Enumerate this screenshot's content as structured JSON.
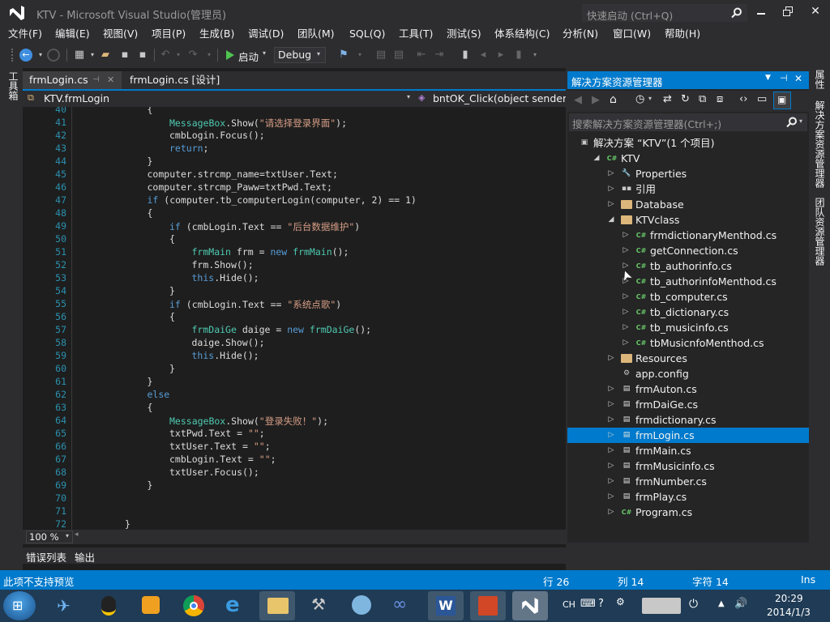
{
  "window": {
    "title": "KTV - Microsoft Visual Studio(管理员)",
    "quick_launch_placeholder": "快速启动 (Ctrl+Q)"
  },
  "menu": [
    "文件(F)",
    "编辑(E)",
    "视图(V)",
    "项目(P)",
    "生成(B)",
    "调试(D)",
    "团队(M)",
    "SQL(Q)",
    "工具(T)",
    "测试(S)",
    "体系结构(C)",
    "分析(N)",
    "窗口(W)",
    "帮助(H)"
  ],
  "toolbar": {
    "start_label": "启动",
    "config_value": "Debug"
  },
  "left_strip": {
    "toolbox_label": "工具箱"
  },
  "right_strip": {
    "properties_label": "属性",
    "solution_explorer_label": "解决方案资源管理器",
    "team_explorer_label": "团队资源管理器"
  },
  "editor": {
    "tabs": [
      {
        "label": "frmLogin.cs",
        "active": true
      },
      {
        "label": "frmLogin.cs [设计]",
        "active": false
      }
    ],
    "nav_left": "KTV.frmLogin",
    "nav_right": "bntOK_Click(object sender, E",
    "zoom": "100 %",
    "lines": [
      {
        "n": "40",
        "indent": 3,
        "parts": [
          [
            "p",
            "{"
          ]
        ]
      },
      {
        "n": "41",
        "indent": 4,
        "parts": [
          [
            "t",
            "MessageBox"
          ],
          [
            "p",
            ".Show("
          ],
          [
            "s",
            "\"请选择登录界面\""
          ],
          [
            "p",
            ");"
          ]
        ]
      },
      {
        "n": "42",
        "indent": 4,
        "parts": [
          [
            "p",
            "cmbLogin.Focus();"
          ]
        ]
      },
      {
        "n": "43",
        "indent": 4,
        "parts": [
          [
            "k",
            "return"
          ],
          [
            "p",
            ";"
          ]
        ]
      },
      {
        "n": "44",
        "indent": 3,
        "parts": [
          [
            "p",
            "}"
          ]
        ]
      },
      {
        "n": "45",
        "indent": 3,
        "parts": [
          [
            "p",
            "computer.strcmp_name=txtUser.Text;"
          ]
        ]
      },
      {
        "n": "46",
        "indent": 3,
        "parts": [
          [
            "p",
            "computer.strcmp_Paww=txtPwd.Text;"
          ]
        ]
      },
      {
        "n": "47",
        "indent": 3,
        "parts": [
          [
            "k",
            "if"
          ],
          [
            "p",
            " (computer.tb_computerLogin(computer, 2) == 1)"
          ]
        ]
      },
      {
        "n": "48",
        "indent": 3,
        "parts": [
          [
            "p",
            "{"
          ]
        ]
      },
      {
        "n": "49",
        "indent": 4,
        "parts": [
          [
            "k",
            "if"
          ],
          [
            "p",
            " (cmbLogin.Text == "
          ],
          [
            "s",
            "\"后台数据维护\""
          ],
          [
            "p",
            ")"
          ]
        ]
      },
      {
        "n": "50",
        "indent": 4,
        "parts": [
          [
            "p",
            "{"
          ]
        ]
      },
      {
        "n": "51",
        "indent": 5,
        "parts": [
          [
            "t",
            "frmMain"
          ],
          [
            "p",
            " frm = "
          ],
          [
            "k",
            "new"
          ],
          [
            "p",
            " "
          ],
          [
            "t",
            "frmMain"
          ],
          [
            "p",
            "();"
          ]
        ]
      },
      {
        "n": "52",
        "indent": 5,
        "parts": [
          [
            "p",
            "frm.Show();"
          ]
        ]
      },
      {
        "n": "53",
        "indent": 5,
        "parts": [
          [
            "k",
            "this"
          ],
          [
            "p",
            ".Hide();"
          ]
        ]
      },
      {
        "n": "54",
        "indent": 4,
        "parts": [
          [
            "p",
            "}"
          ]
        ]
      },
      {
        "n": "55",
        "indent": 4,
        "parts": [
          [
            "k",
            "if"
          ],
          [
            "p",
            " (cmbLogin.Text == "
          ],
          [
            "s",
            "\"系统点歌\""
          ],
          [
            "p",
            ")"
          ]
        ]
      },
      {
        "n": "56",
        "indent": 4,
        "parts": [
          [
            "p",
            "{"
          ]
        ]
      },
      {
        "n": "57",
        "indent": 5,
        "parts": [
          [
            "t",
            "frmDaiGe"
          ],
          [
            "p",
            " daige = "
          ],
          [
            "k",
            "new"
          ],
          [
            "p",
            " "
          ],
          [
            "t",
            "frmDaiGe"
          ],
          [
            "p",
            "();"
          ]
        ]
      },
      {
        "n": "58",
        "indent": 5,
        "parts": [
          [
            "p",
            "daige.Show();"
          ]
        ]
      },
      {
        "n": "59",
        "indent": 5,
        "parts": [
          [
            "k",
            "this"
          ],
          [
            "p",
            ".Hide();"
          ]
        ]
      },
      {
        "n": "60",
        "indent": 4,
        "parts": [
          [
            "p",
            "}"
          ]
        ]
      },
      {
        "n": "61",
        "indent": 3,
        "parts": [
          [
            "p",
            "}"
          ]
        ]
      },
      {
        "n": "62",
        "indent": 3,
        "parts": [
          [
            "k",
            "else"
          ]
        ]
      },
      {
        "n": "63",
        "indent": 3,
        "parts": [
          [
            "p",
            "{"
          ]
        ]
      },
      {
        "n": "64",
        "indent": 4,
        "parts": [
          [
            "t",
            "MessageBox"
          ],
          [
            "p",
            ".Show("
          ],
          [
            "s",
            "\"登录失败！\""
          ],
          [
            "p",
            ");"
          ]
        ]
      },
      {
        "n": "65",
        "indent": 4,
        "parts": [
          [
            "p",
            "txtPwd.Text = "
          ],
          [
            "s",
            "\"\""
          ],
          [
            "p",
            ";"
          ]
        ]
      },
      {
        "n": "66",
        "indent": 4,
        "parts": [
          [
            "p",
            "txtUser.Text = "
          ],
          [
            "s",
            "\"\""
          ],
          [
            "p",
            ";"
          ]
        ]
      },
      {
        "n": "67",
        "indent": 4,
        "parts": [
          [
            "p",
            "cmbLogin.Text = "
          ],
          [
            "s",
            "\"\""
          ],
          [
            "p",
            ";"
          ]
        ]
      },
      {
        "n": "68",
        "indent": 4,
        "parts": [
          [
            "p",
            "txtUser.Focus();"
          ]
        ]
      },
      {
        "n": "69",
        "indent": 3,
        "parts": [
          [
            "p",
            "}"
          ]
        ]
      },
      {
        "n": "70",
        "indent": 0,
        "parts": []
      },
      {
        "n": "71",
        "indent": 0,
        "parts": []
      },
      {
        "n": "72",
        "indent": 2,
        "parts": [
          [
            "p",
            "}"
          ]
        ]
      }
    ]
  },
  "output_tabs": [
    "错误列表",
    "输出"
  ],
  "solution_explorer": {
    "title": "解决方案资源管理器",
    "search_placeholder": "搜索解决方案资源管理器(Ctrl+;)",
    "tree": [
      {
        "label": "解决方案 “KTV”(1 个项目)",
        "level": 0,
        "arrow": "",
        "icon": "solution"
      },
      {
        "label": "KTV",
        "level": 1,
        "arrow": "open",
        "icon": "csproj"
      },
      {
        "label": "Properties",
        "level": 2,
        "arrow": "closed",
        "icon": "wrench"
      },
      {
        "label": "引用",
        "level": 2,
        "arrow": "closed",
        "icon": "ref"
      },
      {
        "label": "Database",
        "level": 2,
        "arrow": "closed",
        "icon": "folder"
      },
      {
        "label": "KTVclass",
        "level": 2,
        "arrow": "open",
        "icon": "folder"
      },
      {
        "label": "frmdictionaryMenthod.cs",
        "level": 3,
        "arrow": "closed",
        "icon": "cs"
      },
      {
        "label": "getConnection.cs",
        "level": 3,
        "arrow": "closed",
        "icon": "cs"
      },
      {
        "label": "tb_authorinfo.cs",
        "level": 3,
        "arrow": "closed",
        "icon": "cs"
      },
      {
        "label": "tb_authorinfoMenthod.cs",
        "level": 3,
        "arrow": "closed",
        "icon": "cs"
      },
      {
        "label": "tb_computer.cs",
        "level": 3,
        "arrow": "closed",
        "icon": "cs"
      },
      {
        "label": "tb_dictionary.cs",
        "level": 3,
        "arrow": "closed",
        "icon": "cs"
      },
      {
        "label": "tb_musicinfo.cs",
        "level": 3,
        "arrow": "closed",
        "icon": "cs"
      },
      {
        "label": "tbMusicnfoMenthod.cs",
        "level": 3,
        "arrow": "closed",
        "icon": "cs"
      },
      {
        "label": "Resources",
        "level": 2,
        "arrow": "closed",
        "icon": "folder"
      },
      {
        "label": "app.config",
        "level": 2,
        "arrow": "",
        "icon": "config"
      },
      {
        "label": "frmAuton.cs",
        "level": 2,
        "arrow": "closed",
        "icon": "form"
      },
      {
        "label": "frmDaiGe.cs",
        "level": 2,
        "arrow": "closed",
        "icon": "form"
      },
      {
        "label": "frmdictionary.cs",
        "level": 2,
        "arrow": "closed",
        "icon": "form"
      },
      {
        "label": "frmLogin.cs",
        "level": 2,
        "arrow": "closed",
        "icon": "form",
        "selected": true
      },
      {
        "label": "frmMain.cs",
        "level": 2,
        "arrow": "closed",
        "icon": "form"
      },
      {
        "label": "frmMusicinfo.cs",
        "level": 2,
        "arrow": "closed",
        "icon": "form"
      },
      {
        "label": "frmNumber.cs",
        "level": 2,
        "arrow": "closed",
        "icon": "form"
      },
      {
        "label": "frmPlay.cs",
        "level": 2,
        "arrow": "closed",
        "icon": "form"
      },
      {
        "label": "Program.cs",
        "level": 2,
        "arrow": "closed",
        "icon": "cs"
      }
    ]
  },
  "status": {
    "message": "此项不支持预览",
    "line": "行 26",
    "col": "列 14",
    "char": "字符 14",
    "mode": "Ins"
  },
  "taskbar": {
    "ime": "CH",
    "time": "20:29",
    "date": "2014/1/3"
  },
  "colors": {
    "accent": "#007acc",
    "bg": "#2d2d30",
    "editor_bg": "#1e1e1e",
    "keyword": "#569cd6",
    "type": "#4ec9b0",
    "string": "#d69d85",
    "line_number": "#2b91af"
  }
}
